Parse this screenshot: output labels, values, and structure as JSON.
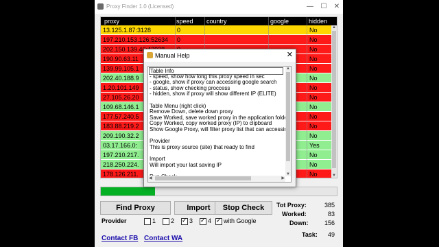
{
  "window": {
    "title": "Proxy Finder 1.0 (Licensed)"
  },
  "grid": {
    "columns": [
      "proxy",
      "speed",
      "country",
      "google",
      "hidden"
    ],
    "rows": [
      {
        "proxy": "13.125.1.87:3128",
        "speed": "0",
        "country": "",
        "google": "",
        "hidden": "No",
        "color": "#ffd700"
      },
      {
        "proxy": "197.210.153.126:52634",
        "speed": "0",
        "country": "",
        "google": "",
        "hidden": "No",
        "color": "#ff1a1a"
      },
      {
        "proxy": "202.150.139.46:43938",
        "speed": "0",
        "country": "",
        "google": "",
        "hidden": "No",
        "color": "#ff1a1a"
      },
      {
        "proxy": "190.90.63.11",
        "speed": "",
        "country": "",
        "google": "",
        "hidden": "No",
        "color": "#ff1a1a"
      },
      {
        "proxy": "139.99.105.1",
        "speed": "",
        "country": "",
        "google": "",
        "hidden": "No",
        "color": "#ff1a1a"
      },
      {
        "proxy": "202.40.188.9",
        "speed": "",
        "country": "",
        "google": "",
        "hidden": "No",
        "color": "#90ee90"
      },
      {
        "proxy": "1.20.101.149",
        "speed": "",
        "country": "",
        "google": "",
        "hidden": "No",
        "color": "#ff1a1a"
      },
      {
        "proxy": "27.105.26.20",
        "speed": "",
        "country": "",
        "google": "",
        "hidden": "No",
        "color": "#ff1a1a"
      },
      {
        "proxy": "109.68.146.1",
        "speed": "",
        "country": "",
        "google": "",
        "hidden": "No",
        "color": "#90ee90"
      },
      {
        "proxy": "177.57.240.5",
        "speed": "",
        "country": "",
        "google": "",
        "hidden": "No",
        "color": "#ff1a1a"
      },
      {
        "proxy": "183.88.219.2",
        "speed": "",
        "country": "",
        "google": "",
        "hidden": "No",
        "color": "#ff1a1a"
      },
      {
        "proxy": "209.190.32.2",
        "speed": "",
        "country": "",
        "google": "",
        "hidden": "No",
        "color": "#90ee90"
      },
      {
        "proxy": "03.17.166.0:",
        "speed": "",
        "country": "",
        "google": "",
        "hidden": "Yes",
        "color": "#90ee90"
      },
      {
        "proxy": "197.210.217.",
        "speed": "",
        "country": "",
        "google": "",
        "hidden": "No",
        "color": "#90ee90"
      },
      {
        "proxy": "218.250.224.",
        "speed": "",
        "country": "",
        "google": "",
        "hidden": "No",
        "color": "#90ee90"
      },
      {
        "proxy": "178.126.211.",
        "speed": "",
        "country": "",
        "google": "",
        "hidden": "No",
        "color": "#ff1a1a"
      }
    ]
  },
  "progress": {
    "value": 0.23,
    "color": "#06b025"
  },
  "buttons": {
    "find_proxy": "Find Proxy",
    "import": "Import",
    "stop_check": "Stop Check"
  },
  "stats": {
    "tot_label": "Tot Proxy:",
    "tot_value": "385",
    "worked_label": "Worked:",
    "worked_value": "83",
    "down_label": "Down:",
    "down_value": "156",
    "task_label": "Task:",
    "task_value": "49"
  },
  "provider": {
    "label": "Provider",
    "options": [
      {
        "label": "1",
        "checked": false
      },
      {
        "label": "2",
        "checked": false
      },
      {
        "label": "3",
        "checked": true
      },
      {
        "label": "4",
        "checked": true
      }
    ],
    "with_google": {
      "label": "with Google",
      "checked": true
    }
  },
  "links": {
    "contact_fb": "Contact FB",
    "contact_wa": "Contact WA"
  },
  "help_dialog": {
    "title": "Manual Help",
    "lines": [
      "Table Info",
      "- speed, show how long this proxy speed in sec",
      "- google, show if proxy can accessing google search",
      "- status, show checking proccess",
      "- hidden, show if proxy will show different IP (ELITE)",
      "",
      "Table Menu (right click)",
      "Remove Down, delete down proxy",
      "Save Worked, save worked proxy in the application folder (",
      "Copy Worked, copy worked proxy (IP) to clipboard",
      "Show Google Proxy, will filter proxy list that can accessing g",
      "",
      "Provider",
      "This is proxy source (site) that ready to find",
      "",
      "Import",
      "Will import your last saving IP",
      "",
      "Run Check"
    ]
  }
}
